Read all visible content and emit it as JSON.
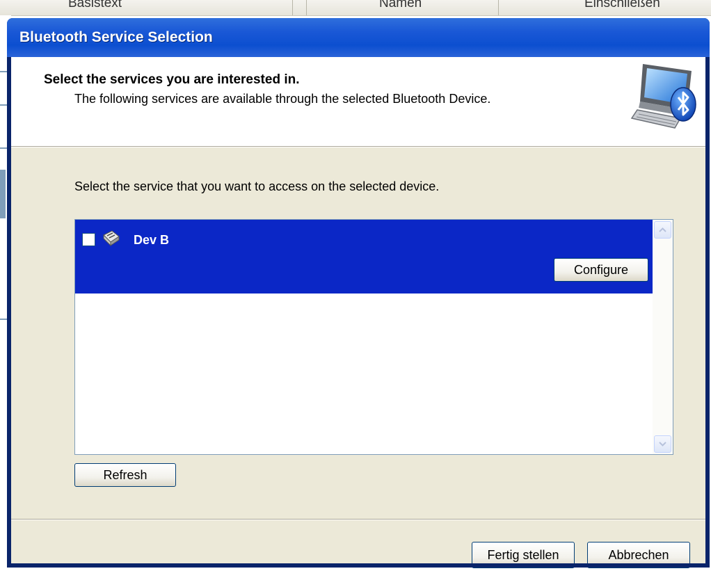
{
  "background": {
    "columns": [
      "Basistext",
      "Namen",
      "Einschließen"
    ]
  },
  "dialog": {
    "title": "Bluetooth Service Selection",
    "header": {
      "title": "Select the services you are interested in.",
      "subtitle": "The following services are available through the selected Bluetooth Device.",
      "icon": "bluetooth-computer-icon"
    },
    "instruction": "Select the service that you want to access on the selected device.",
    "services": [
      {
        "label": "Dev B",
        "checked": false,
        "selected": true,
        "icon": "serial-port-plug-icon",
        "configure_label": "Configure"
      }
    ],
    "refresh_label": "Refresh",
    "finish_label": "Fertig stellen",
    "cancel_label": "Abbrechen"
  },
  "colors": {
    "title_bar": "#0c4fd0",
    "selection": "#0b27c6",
    "dialog_face": "#ece9d8"
  }
}
